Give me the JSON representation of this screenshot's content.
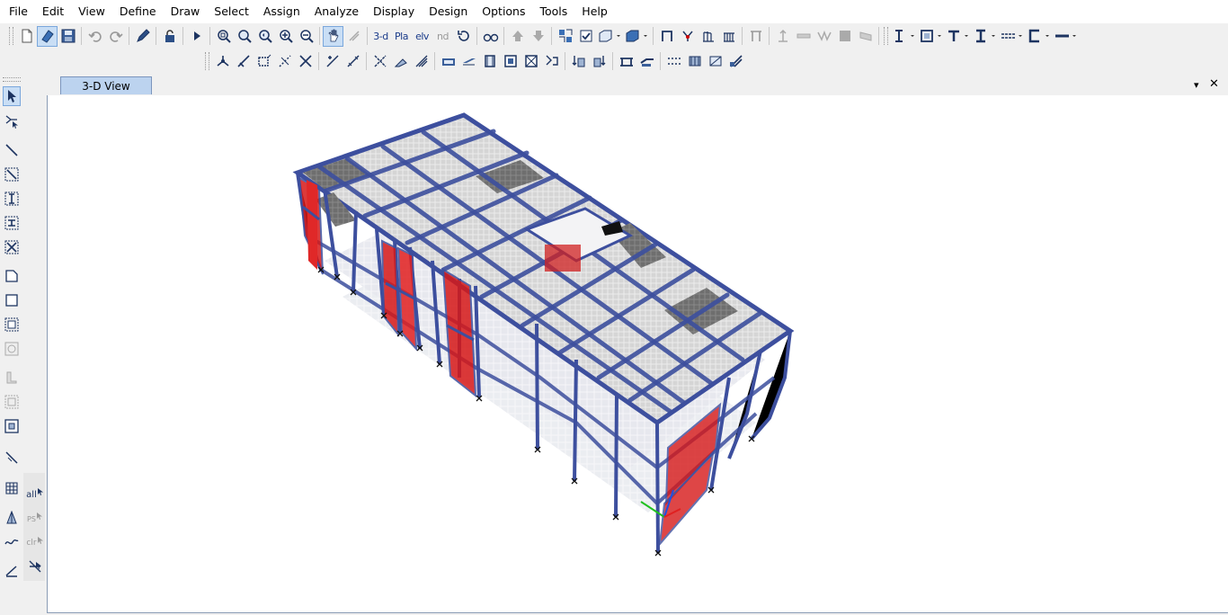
{
  "menu": [
    "File",
    "Edit",
    "View",
    "Define",
    "Draw",
    "Select",
    "Assign",
    "Analyze",
    "Display",
    "Design",
    "Options",
    "Tools",
    "Help"
  ],
  "toolbar": {
    "view_3d": "3-d",
    "view_plan": "Pla",
    "view_elev": "elv",
    "view_nd": "nd"
  },
  "leftbar": {
    "all_label": "all",
    "ps_label": "PS",
    "clr_label": "clr"
  },
  "viewport": {
    "tab_label": "3-D View",
    "dropdown_glyph": "▾",
    "close_glyph": "✕"
  }
}
